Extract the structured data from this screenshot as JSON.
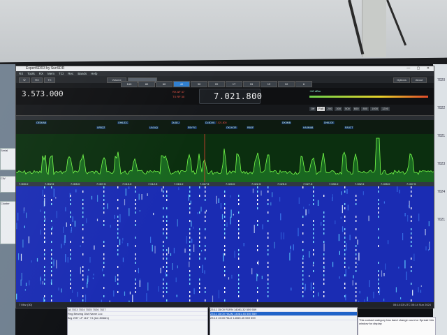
{
  "app": {
    "title": "ExpertSDR3 by SunSDR",
    "menu": [
      "RX",
      "Tools",
      "RX",
      "Mem",
      "TCI",
      "Rec",
      "Bands",
      "Help"
    ],
    "bands": [
      "160",
      "80",
      "60",
      "40",
      "30",
      "20",
      "17",
      "15",
      "12",
      "10",
      "6"
    ],
    "active_band": "40",
    "big_freq": "3.573.000",
    "vfo_freq": "7.021.800",
    "rx_labels": [
      "RX AF 47",
      "RX RF 47"
    ],
    "tx_label": "TX RF 30",
    "smeter_label": "+40 dBm",
    "span_buttons": [
      "Off",
      "Full",
      "200",
      "300",
      "500",
      "600",
      "800",
      "1000",
      "1200"
    ],
    "active_span": "Full",
    "options": "Options",
    "about": "About",
    "vol_label": "Volume"
  },
  "spots": [
    {
      "call": "OE3KAB",
      "red": false
    },
    {
      "call": "UR5ZZ",
      "red": false
    },
    {
      "call": "OH6JDC",
      "red": false
    },
    {
      "call": "UA1AQ",
      "red": false
    },
    {
      "call": "DL6DJ",
      "red": false
    },
    {
      "call": "R5YFO",
      "red": false
    },
    {
      "call": "DL5DXK",
      "red": false
    },
    {
      "call": "OK1KOR",
      "red": false
    },
    {
      "call": "7.021.800",
      "red": true
    },
    {
      "call": "R6DF",
      "red": false
    },
    {
      "call": "DK5MB",
      "red": false
    },
    {
      "call": "HA3MAB",
      "red": false
    },
    {
      "call": "DH8JOE",
      "red": false
    },
    {
      "call": "RA3CT",
      "red": false
    }
  ],
  "freq_ticks": [
    "7.000.0",
    "7.002.5",
    "7.005.0",
    "7.007.5",
    "7.010.0",
    "7.012.5",
    "7.015.0",
    "7.017.5",
    "7.020.0",
    "7.022.5",
    "7.025.0",
    "7.027.5",
    "7.030.0",
    "7.032.5",
    "7.035.0",
    "7.037.5"
  ],
  "status_bar": {
    "left": "7 Mhz (30)",
    "right": "05:14:33 UTC   05:14 Sun 2024"
  },
  "log_left": [
    "JA  7023  7024  7025  7026  7027",
    "Rng  Bearing  Dist  Name  Loc",
    "Brg 295° LP 115° Y4 (km 8068m)"
  ],
  "log_mid": [
    {
      "time": "23:11 15:00",
      "call": "R1RN",
      "freq": "14081.32",
      "mode": "559",
      "rst": "559",
      "sel": false
    },
    {
      "time": "23:11 15:00",
      "call": "HA3M",
      "freq": "14081.45",
      "mode": "559",
      "rst": "559",
      "sel": true
    },
    {
      "time": "23:13 15:00",
      "call": "R6JJ",
      "freq": "14065.45",
      "mode": "559",
      "rst": "559",
      "sel": false
    }
  ],
  "note": "This contact category has band change count or Spread Info window for display",
  "right_numbers": [
    "7020",
    "7022",
    "7021",
    "7023",
    "7024",
    "7021"
  ],
  "colors": {
    "spectrum": "#76ff4a",
    "spectrum_fill": "#1b6e22",
    "waterfall_bg": "#1a2cb3",
    "vfo_marker": "#e04030"
  }
}
